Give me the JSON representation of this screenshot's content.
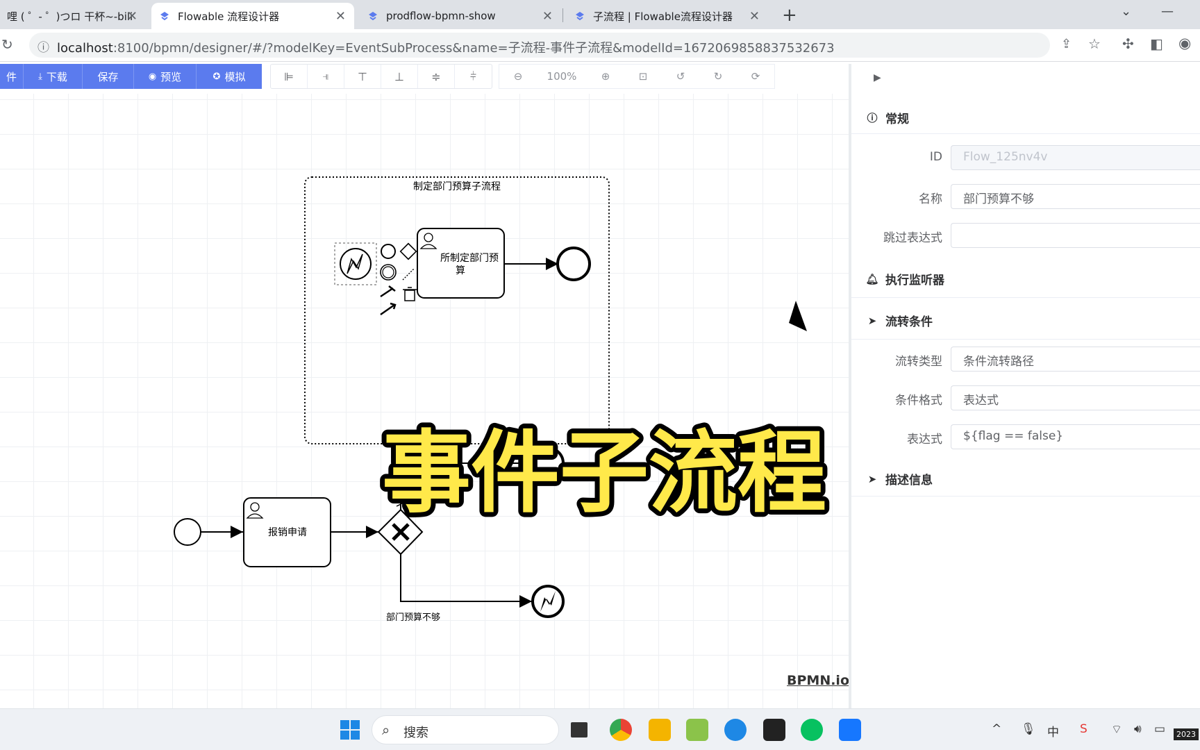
{
  "browser": {
    "tabs": [
      {
        "title": "哩 ( ゜- ゜)つロ 干杯~-bili",
        "active": false
      },
      {
        "title": "Flowable 流程设计器",
        "active": true
      },
      {
        "title": "prodflow-bpmn-show",
        "active": false
      },
      {
        "title": "子流程 | Flowable流程设计器",
        "active": false
      }
    ],
    "url_host": "localhost",
    "url_rest": ":8100/bpmn/designer/#/?modelKey=EventSubProcess&name=子流程-事件子流程&modelId=1672069858837532673"
  },
  "toolbar": {
    "buttons": [
      {
        "label": "件",
        "icon": ""
      },
      {
        "label": "下载",
        "icon": "⤓"
      },
      {
        "label": "保存",
        "icon": ""
      },
      {
        "label": "预览",
        "icon": "◉"
      },
      {
        "label": "模拟",
        "icon": "✪"
      }
    ],
    "zoom": "100%"
  },
  "diagram": {
    "subprocess_label": "制定部门预算子流程",
    "task1_label": "制定部门预算",
    "task1_label_line1": "所制定部门预",
    "task1_label_line2": "算",
    "task2_label": "报销申请",
    "flow_label": "部门预算不够"
  },
  "overlay_title": "事件子流程",
  "bpmn_logo": "BPMN.io",
  "panel": {
    "general_title": "常规",
    "id_label": "ID",
    "id_value": "Flow_125nv4v",
    "name_label": "名称",
    "name_value": "部门预算不够",
    "skip_label": "跳过表达式",
    "skip_value": "",
    "listener_title": "执行监听器",
    "condition_title": "流转条件",
    "flow_type_label": "流转类型",
    "flow_type_value": "条件流转路径",
    "cond_format_label": "条件格式",
    "cond_format_value": "表达式",
    "expr_label": "表达式",
    "expr_value": "${flag == false}",
    "desc_title": "描述信息"
  },
  "taskbar": {
    "search_placeholder": "搜索",
    "ime": "中",
    "clock": "2023"
  },
  "colors": {
    "primary": "#5b7bee",
    "overlay_yellow": "#ffe94a"
  }
}
